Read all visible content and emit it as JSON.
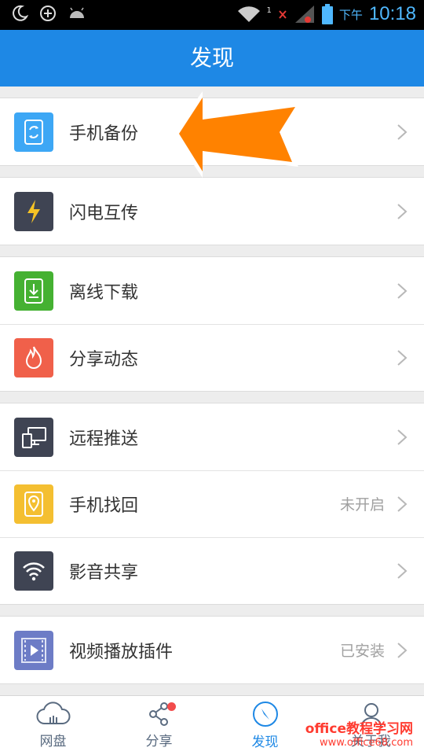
{
  "status_bar": {
    "time": "10:18",
    "ampm": "下午",
    "notif_count": "1"
  },
  "header": {
    "title": "发现"
  },
  "groups": [
    {
      "items": [
        {
          "label": "手机备份",
          "icon": "phone-backup-icon",
          "color": "#3da7f5"
        }
      ]
    },
    {
      "items": [
        {
          "label": "闪电互传",
          "icon": "lightning-icon",
          "color": "#3f4453"
        }
      ]
    },
    {
      "items": [
        {
          "label": "离线下载",
          "icon": "download-icon",
          "color": "#45b132"
        },
        {
          "label": "分享动态",
          "icon": "flame-icon",
          "color": "#f0604a"
        }
      ]
    },
    {
      "items": [
        {
          "label": "远程推送",
          "icon": "remote-push-icon",
          "color": "#3f4453"
        },
        {
          "label": "手机找回",
          "icon": "phone-locate-icon",
          "color": "#f4bf31",
          "status": "未开启"
        },
        {
          "label": "影音共享",
          "icon": "wifi-icon",
          "color": "#3f4453"
        }
      ]
    },
    {
      "items": [
        {
          "label": "视频播放插件",
          "icon": "video-player-icon",
          "color": "#6d7cc6",
          "status": "已安装"
        }
      ]
    }
  ],
  "tabs": [
    {
      "label": "网盘",
      "icon": "cloud-icon"
    },
    {
      "label": "分享",
      "icon": "share-icon",
      "badge": true
    },
    {
      "label": "发现",
      "icon": "compass-icon",
      "active": true
    },
    {
      "label": "关于我",
      "icon": "profile-icon"
    }
  ],
  "watermark": {
    "line1": "office教程学习网",
    "line2": "www.office68.com"
  }
}
